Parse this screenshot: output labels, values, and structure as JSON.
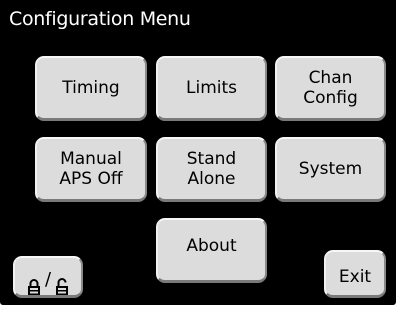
{
  "title": "Configuration Menu",
  "buttons": {
    "timing": "Timing",
    "limits": "Limits",
    "chan_config": "Chan\nConfig",
    "manual_aps_off": "Manual\nAPS Off",
    "stand_alone": "Stand\nAlone",
    "system": "System",
    "about": "About",
    "exit": "Exit",
    "lock_separator": "/"
  },
  "icons": {
    "lock": "lock-icon",
    "unlock": "unlock-icon"
  },
  "colors": {
    "screen_bg": "#000000",
    "button_bg": "#dcdcdc",
    "title_text": "#ffffff"
  }
}
